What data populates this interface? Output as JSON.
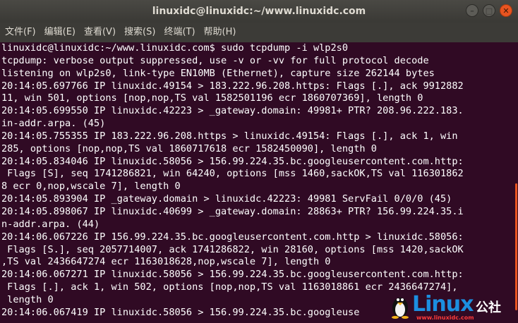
{
  "window": {
    "title": "linuxidc@linuxidc:~/www.linuxidc.com",
    "minimize_glyph": "–",
    "maximize_glyph": "□",
    "close_glyph": "✕"
  },
  "menu": [
    "文件(F)",
    "编辑(E)",
    "查看(V)",
    "搜索(S)",
    "终端(T)",
    "帮助(H)"
  ],
  "terminal": {
    "lines": [
      "linuxidc@linuxidc:~/www.linuxidc.com$ sudo tcpdump -i wlp2s0",
      "tcpdump: verbose output suppressed, use -v or -vv for full protocol decode",
      "listening on wlp2s0, link-type EN10MB (Ethernet), capture size 262144 bytes",
      "20:14:05.697766 IP linuxidc.49154 > 183.222.96.208.https: Flags [.], ack 9912882",
      "11, win 501, options [nop,nop,TS val 1582501196 ecr 1860707369], length 0",
      "20:14:05.699550 IP linuxidc.42223 > _gateway.domain: 49981+ PTR? 208.96.222.183.",
      "in-addr.arpa. (45)",
      "20:14:05.755355 IP 183.222.96.208.https > linuxidc.49154: Flags [.], ack 1, win",
      "285, options [nop,nop,TS val 1860717618 ecr 1582450090], length 0",
      "20:14:05.834046 IP linuxidc.58056 > 156.99.224.35.bc.googleusercontent.com.http:",
      " Flags [S], seq 1741286821, win 64240, options [mss 1460,sackOK,TS val 116301862",
      "8 ecr 0,nop,wscale 7], length 0",
      "20:14:05.893904 IP _gateway.domain > linuxidc.42223: 49981 ServFail 0/0/0 (45)",
      "20:14:05.898067 IP linuxidc.40699 > _gateway.domain: 28863+ PTR? 156.99.224.35.i",
      "n-addr.arpa. (44)",
      "20:14:06.067226 IP 156.99.224.35.bc.googleusercontent.com.http > linuxidc.58056:",
      " Flags [S.], seq 2057714007, ack 1741286822, win 28160, options [mss 1420,sackOK",
      ",TS val 2436647274 ecr 1163018628,nop,wscale 7], length 0",
      "20:14:06.067271 IP linuxidc.58056 > 156.99.224.35.bc.googleusercontent.com.http:",
      " Flags [.], ack 1, win 502, options [nop,nop,TS val 1163018861 ecr 2436647274],",
      " length 0",
      "20:14:06.067419 IP linuxidc.58056 > 156.99.224.35.bc.googleuse"
    ]
  },
  "watermark": {
    "brand": "Linux",
    "suffix": "公社",
    "url": "www.linuxidc.com"
  },
  "colors": {
    "terminal_bg": "#300a24",
    "terminal_fg": "#ffffff",
    "titlebar_bg": "#3c3b37",
    "accent": "#e95420"
  }
}
